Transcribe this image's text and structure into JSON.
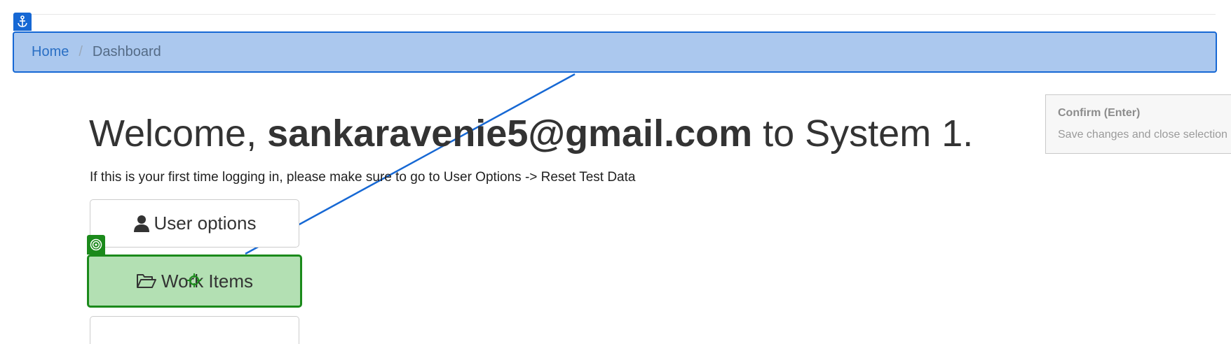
{
  "breadcrumb": {
    "home": "Home",
    "separator": "/",
    "current": "Dashboard"
  },
  "welcome": {
    "prefix": "Welcome,",
    "username": "sankaravenie5@gmail.com",
    "suffix": "to System 1."
  },
  "subtitle": "If this is your first time logging in, please make sure to go to User Options -> Reset Test Data",
  "buttons": {
    "user_options": "User options",
    "work_items": "Work Items"
  },
  "tooltip": {
    "title": "Confirm (Enter)",
    "body": "Save changes and close selection"
  },
  "icons": {
    "breadcrumb_badge": "anchor-icon",
    "user_options": "user-icon",
    "work_items": "folder-open-icon",
    "target_badge": "target-icon",
    "cursor": "crosshair-cursor-icon"
  },
  "colors": {
    "highlight_blue": "#1668d4",
    "breadcrumb_fill": "#abc8ee",
    "highlight_green": "#1b8a1b",
    "work_items_fill": "#b3e0b3"
  }
}
